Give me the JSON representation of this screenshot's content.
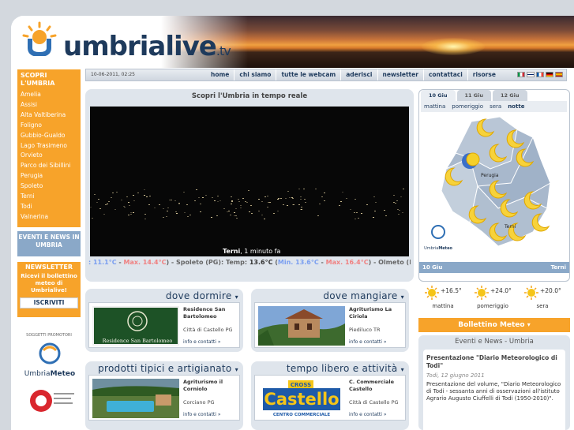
{
  "brand": {
    "name": "umbrialive",
    "tld": ".tv"
  },
  "sidebar": {
    "title": "SCOPRI L'UMBRIA",
    "items": [
      {
        "label": "Amelia"
      },
      {
        "label": "Assisi"
      },
      {
        "label": "Alta Valtiberina"
      },
      {
        "label": "Foligno"
      },
      {
        "label": "Gubbio-Gualdo"
      },
      {
        "label": "Lago Trasimeno"
      },
      {
        "label": "Orvieto"
      },
      {
        "label": "Parco dei Sibillini"
      },
      {
        "label": "Perugia"
      },
      {
        "label": "Spoleto"
      },
      {
        "label": "Terni"
      },
      {
        "label": "Todi"
      },
      {
        "label": "Valnerina"
      }
    ],
    "events_box": "EVENTI E NEWS IN UMBRIA",
    "newsletter": {
      "title": "NEWSLETTER",
      "text": "Ricevi il bollettino meteo di Umbrialive!",
      "button": "ISCRIVITI"
    },
    "promoters_title": "SOGGETTI PROMOTORI",
    "promoter1": {
      "part1": "Umbria",
      "part2": "Meteo"
    }
  },
  "navbar": {
    "datetime": "10-06-2011, 02:25",
    "items": [
      {
        "label": "home"
      },
      {
        "label": "chi siamo"
      },
      {
        "label": "tutte le webcam"
      },
      {
        "label": "aderisci"
      },
      {
        "label": "newsletter"
      },
      {
        "label": "contattaci"
      },
      {
        "label": "risorse"
      }
    ]
  },
  "webcam": {
    "title": "Scopri l'Umbria in tempo reale",
    "caption_place": "Terni",
    "caption_time": ", 1 minuto fa",
    "ticker": {
      "lead": ": 11.1°C",
      "sep1": " - ",
      "max1": "Max. 14.4°C",
      "mid": ") - Spoleto (PG): Temp: ",
      "temp2": "13.6°C",
      "open2": " (",
      "min2": "Min. 13.6°C",
      "sep2": " - ",
      "max2": "Max. 16.4°C",
      "tail": ") - Olmeto (PG): Temp"
    }
  },
  "weather": {
    "tabs": [
      {
        "label": "10 Giu"
      },
      {
        "label": "11 Giu"
      },
      {
        "label": "12 Giu"
      }
    ],
    "times": [
      {
        "label": "mattina"
      },
      {
        "label": "pomeriggio"
      },
      {
        "label": "sera"
      },
      {
        "label": "notte"
      }
    ],
    "map_labels": {
      "perugia": "Perugia",
      "terni": "Terni",
      "logo1": "Umbria",
      "logo2": "Meteo"
    },
    "footer_left": "10 Giu",
    "footer_right": "Terni",
    "forecast": [
      {
        "temp": "+16.5°",
        "label": "mattina"
      },
      {
        "temp": "+24.0°",
        "label": "pomeriggio"
      },
      {
        "temp": "+20.0°",
        "label": "sera"
      }
    ]
  },
  "bollettino": "Bollettino Meteo",
  "events": {
    "title": "Eventi e News - Umbria",
    "headline": "Presentazione \"Diario Meteorologico di Todi\"",
    "date": "Todi, 12 giugno 2011",
    "body": "Presentazione del volume, \"Diario Meteorologico di Todi - sessanta anni di osservazioni all'istituto Agrario Augusto Ciuffelli di Todi (1950-2010)\"."
  },
  "sections": {
    "dormire": {
      "title": "dove dormire",
      "name": "Residence San Bartolomeo",
      "sign": "Residence San Bartolomeo",
      "loc": "Città di Castello PG",
      "link": "info e contatti »"
    },
    "mangiare": {
      "title": "dove mangiare",
      "name": "Agriturismo La Ciriola",
      "loc": "Piediluco TR",
      "link": "info e contatti »"
    },
    "prodotti": {
      "title": "prodotti tipici e artigianato",
      "name": "Agriturismo il Corniolo",
      "loc": "Corciano PG",
      "link": "info e contatti »"
    },
    "tempo": {
      "title": "tempo libero e attività",
      "name": "C. Commerciale Castello",
      "loc": "Città di Castello PG",
      "link": "info e contatti »",
      "logo_top": "CROSS",
      "logo_main": "Castello",
      "logo_sub": "CENTRO COMMERCIALE"
    }
  },
  "colors": {
    "orange": "#f7a32a",
    "navy": "#1e3a5c",
    "panel": "#dfe5ec",
    "blue": "#8aa8c8"
  }
}
